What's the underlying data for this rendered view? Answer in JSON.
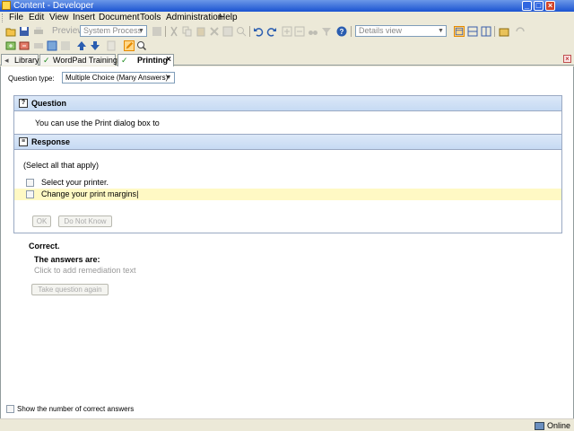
{
  "window": {
    "title": "Content - Developer",
    "min": "_",
    "max": "□",
    "close": "×"
  },
  "menu": [
    "File",
    "Edit",
    "View",
    "Insert",
    "Document",
    "Tools",
    "Administration",
    "Help"
  ],
  "toolbar": {
    "preview_label": "Preview",
    "process_value": "System Process",
    "view_value": "Details view",
    "help_glyph": "?"
  },
  "tabs": [
    {
      "label": "Library",
      "icon": "book-icon",
      "active": false
    },
    {
      "label": "WordPad Training",
      "icon": "check-icon",
      "active": false
    },
    {
      "label": "Printing",
      "icon": "check-icon",
      "active": true,
      "close": "×"
    }
  ],
  "doc_close": "×",
  "question_type": {
    "label": "Question type:",
    "value": "Multiple Choice (Many Answers)"
  },
  "question": {
    "heading": "Question",
    "text": "You can use the Print dialog box to"
  },
  "response": {
    "heading": "Response",
    "instruction": "(Select all that apply)",
    "options": [
      {
        "text": "Select your printer.",
        "checked": false,
        "selected": false
      },
      {
        "text": "Change your print margins",
        "checked": false,
        "selected": true
      }
    ],
    "ok_label": "OK",
    "dont_know_label": "Do Not Know"
  },
  "feedback": {
    "correct_label": "Correct.",
    "answers_label": "The answers are:",
    "remediation_placeholder": "Click to add remediation text",
    "take_again_label": "Take question again"
  },
  "show_correct_label": "Show the number of correct answers",
  "status": {
    "online": "Online"
  }
}
